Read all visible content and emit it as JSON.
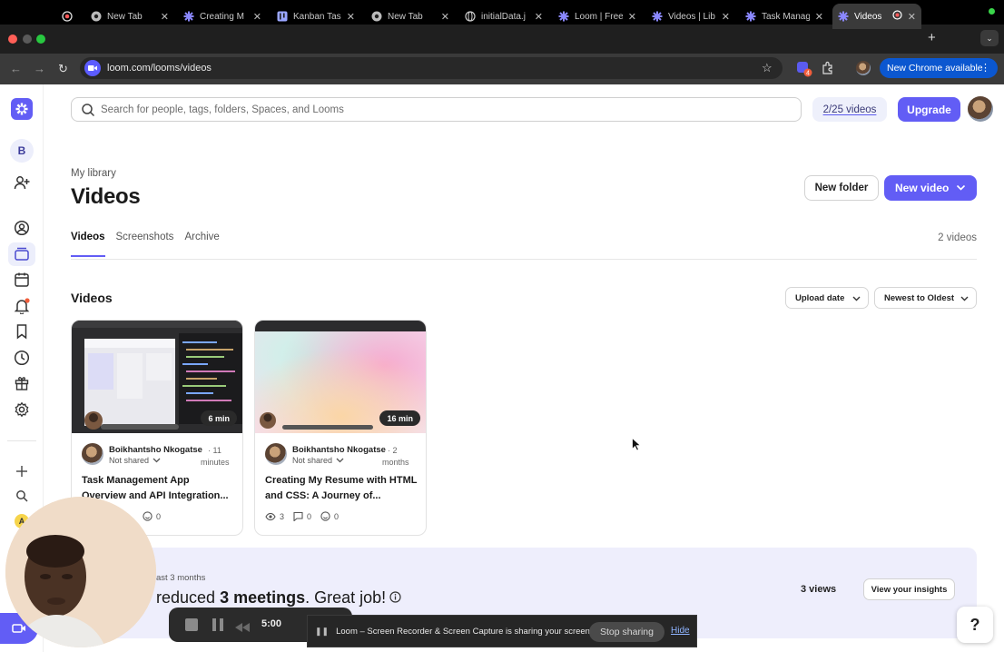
{
  "browser": {
    "tabs": [
      {
        "title": "",
        "icon": "record-icon"
      },
      {
        "title": "New Tab",
        "icon": "chrome-icon"
      },
      {
        "title": "Creating M",
        "icon": "loom-icon"
      },
      {
        "title": "Kanban Tas",
        "icon": "kanban-icon"
      },
      {
        "title": "New Tab",
        "icon": "chrome-icon"
      },
      {
        "title": "initialData.j",
        "icon": "globe-icon"
      },
      {
        "title": "Loom | Free",
        "icon": "loom-icon"
      },
      {
        "title": "Videos | Lib",
        "icon": "loom-icon"
      },
      {
        "title": "Task Manag",
        "icon": "loom-icon"
      },
      {
        "title": "Videos",
        "icon": "loom-icon",
        "active": true
      }
    ],
    "url": "loom.com/looms/videos",
    "extension_badge": "4",
    "chrome_button": "New Chrome available"
  },
  "sidebar": {
    "workspace_initial": "B",
    "user_badge": "A"
  },
  "header": {
    "search_placeholder": "Search for people, tags, folders, Spaces, and Looms",
    "quota": "2/25 videos",
    "upgrade": "Upgrade"
  },
  "page": {
    "breadcrumb": "My library",
    "title": "Videos",
    "new_folder": "New folder",
    "new_video": "New video",
    "tabs": [
      "Videos",
      "Screenshots",
      "Archive"
    ],
    "active_tab": "Videos",
    "count": "2 videos",
    "section_title": "Videos",
    "sort_field": "Upload date",
    "sort_order": "Newest to Oldest"
  },
  "videos": [
    {
      "duration": "6 min",
      "author": "Boikhantsho Nkogatse",
      "ago_line1": "· 11",
      "ago_line2": "minutes",
      "sharing": "Not shared",
      "title": "Task Management App Overview and API Integration...",
      "views": "",
      "comments": "",
      "reactions": "0"
    },
    {
      "duration": "16 min",
      "author": "Boikhantsho Nkogatse",
      "ago_line1": "· 2",
      "ago_line2": "months",
      "sharing": "Not shared",
      "title": "Creating My Resume with HTML and CSS: A Journey of...",
      "views": "3",
      "comments": "0",
      "reactions": "0"
    }
  ],
  "insights": {
    "subtitle": "ast 3 months",
    "text_before": "reduced ",
    "text_bold": "3 meetings",
    "text_after": ". Great job!",
    "views": "3 views",
    "button": "View your insights"
  },
  "recorder": {
    "time": "5:00",
    "share_text": "Loom – Screen Recorder & Screen Capture is sharing your screen.",
    "stop": "Stop sharing",
    "hide": "Hide"
  },
  "help": "?",
  "colors": {
    "accent": "#625df5",
    "chrome_blue": "#0b57d0",
    "notification_dot": "#f05d3b"
  }
}
